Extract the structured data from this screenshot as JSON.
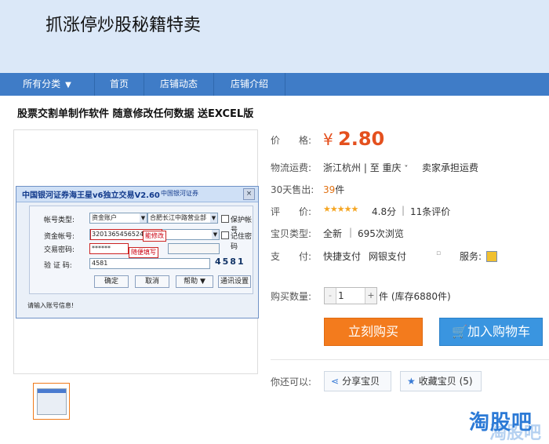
{
  "shop": {
    "title": "抓涨停炒股秘籍特卖"
  },
  "nav": {
    "items": [
      {
        "label": "所有分类",
        "caret": "▼"
      },
      {
        "label": "首页"
      },
      {
        "label": "店铺动态"
      },
      {
        "label": "店铺介绍"
      }
    ]
  },
  "product": {
    "title": "股票交割单制作软件 随意修改任何数据 送EXCEL版",
    "image": {
      "dialog_title": "中国银河证券海王星v6独立交易V2.60",
      "dialog_logo": "中国银河证券",
      "close": "×",
      "account_type_label": "帐号类型:",
      "account_type_value": "资金账户",
      "branch_value": "合肥长江中路营业部",
      "protect_account": "保护帐号",
      "fund_account_label": "资金帐号:",
      "fund_account_value": "3201365456524",
      "fund_account_note": "能修改",
      "remember_password": "记住密码",
      "trade_password_label": "交易密码:",
      "trade_password_value": "******",
      "trade_password_note": "随便填写",
      "captcha_label": "验 证 码:",
      "captcha_input": "4581",
      "captcha_image": "4581",
      "buttons": [
        "确定",
        "取消",
        "帮助 ▼",
        "通讯设置"
      ],
      "status": "请输入账号信息!"
    }
  },
  "info": {
    "price_label": "价　　格:",
    "currency": "¥",
    "price": "2.80",
    "shipping_label": "物流运费:",
    "shipping_from": "浙江杭州",
    "shipping_sep": " | 至 ",
    "shipping_to": "重庆",
    "shipping_caret": "˅",
    "shipping_fee": "卖家承担运费",
    "sold_label": "30天售出:",
    "sold_count": "39",
    "sold_unit": "件",
    "rating_label": "评　　价:",
    "stars": "★★★★★",
    "rating_score": "4.8分",
    "rating_sep": "|",
    "review_count": "11条评价",
    "type_label": "宝贝类型:",
    "type_value": "全新",
    "type_sep": "|",
    "views": "695次浏览",
    "payment_label": "支　　付:",
    "payment_1": "快捷支付",
    "payment_2": "网银支付",
    "service_label": "服务:",
    "qty_label": "购买数量:",
    "qty_minus": "-",
    "qty_value": "1",
    "qty_plus": "+",
    "qty_unit": "件 (库存6880件)",
    "buy_button": "立刻购买",
    "cart_button": "加入购物车",
    "can_also_label": "你还可以:",
    "share_button": "分享宝贝",
    "collect_button": "收藏宝贝 (5)"
  },
  "watermark": {
    "text": "淘股吧",
    "shadow": "淘股吧"
  },
  "colors": {
    "nav": "#3f7cc7",
    "price": "#e4501e",
    "buy": "#f37b1d",
    "cart": "#3a95e0",
    "header": "#dbe8f8"
  }
}
